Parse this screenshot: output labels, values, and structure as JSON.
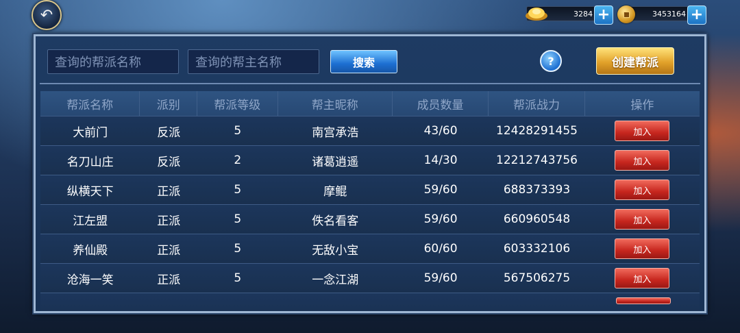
{
  "topbar": {
    "back_icon": "back-arrow-icon",
    "gold_amount": "3284",
    "coin_amount": "3453164"
  },
  "search": {
    "guild_name_placeholder": "查询的帮派名称",
    "leader_name_placeholder": "查询的帮主名称",
    "search_label": "搜索",
    "help_label": "?",
    "create_label": "创建帮派"
  },
  "table": {
    "headers": [
      "帮派名称",
      "派别",
      "帮派等级",
      "帮主昵称",
      "成员数量",
      "帮派战力",
      "操作"
    ],
    "join_label": "加入",
    "rows": [
      {
        "name": "大前门",
        "faction": "反派",
        "level": "5",
        "leader": "南宫承浩",
        "members": "43/60",
        "power": "12428291455"
      },
      {
        "name": "名刀山庄",
        "faction": "反派",
        "level": "2",
        "leader": "诸葛逍遥",
        "members": "14/30",
        "power": "12212743756"
      },
      {
        "name": "纵横天下",
        "faction": "正派",
        "level": "5",
        "leader": "摩鲲",
        "members": "59/60",
        "power": "688373393"
      },
      {
        "name": "江左盟",
        "faction": "正派",
        "level": "5",
        "leader": "佚名看客",
        "members": "59/60",
        "power": "660960548"
      },
      {
        "name": "养仙殿",
        "faction": "正派",
        "level": "5",
        "leader": "无敌小宝",
        "members": "60/60",
        "power": "603332106"
      },
      {
        "name": "沧海一笑",
        "faction": "正派",
        "level": "5",
        "leader": "一念江湖",
        "members": "59/60",
        "power": "567506275"
      }
    ]
  }
}
